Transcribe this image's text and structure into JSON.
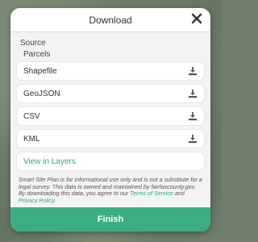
{
  "dialog": {
    "title": "Download",
    "source_label": "Source",
    "source_value": "Parcels",
    "formats": [
      {
        "label": "Shapefile"
      },
      {
        "label": "GeoJSON"
      },
      {
        "label": "CSV"
      },
      {
        "label": "KML"
      }
    ],
    "view_layers_label": "View in Layers",
    "disclaimer": {
      "text_part1": "Smart Site Plan is for informational use only and is not a substitute for a legal survey. This data is owned and maintained by fairfaxcounty.gov. By downloading this data, you agree to our ",
      "terms_link": "Terms of Service",
      "text_part2": " and ",
      "privacy_link": "Privacy Policy",
      "text_part3": "."
    },
    "finish_label": "Finish"
  },
  "colors": {
    "accent": "#3aae82",
    "link": "#2fa77b",
    "icon": "#555555"
  },
  "icons": {
    "close": "close-icon",
    "download": "download-icon"
  }
}
